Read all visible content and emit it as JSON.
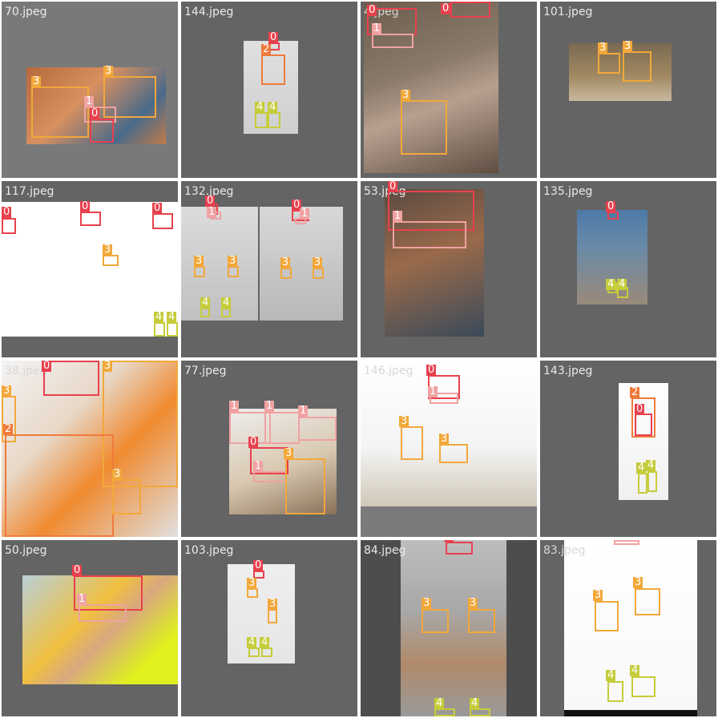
{
  "grid": {
    "tiles": [
      {
        "filename": "70.jpeg",
        "labels": [
          "3",
          "3",
          "1",
          "0"
        ]
      },
      {
        "filename": "144.jpeg",
        "labels": [
          "0",
          "2",
          "4",
          "4"
        ]
      },
      {
        "filename": "4.jpeg",
        "labels": [
          "0",
          "0",
          "1",
          "3"
        ]
      },
      {
        "filename": "101.jpeg",
        "labels": [
          "3",
          "3"
        ]
      },
      {
        "filename": "117.jpeg",
        "labels": [
          "0",
          "0",
          "0",
          "3",
          "4",
          "4"
        ]
      },
      {
        "filename": "132.jpeg",
        "labels": [
          "0",
          "1",
          "3",
          "3",
          "4",
          "4",
          "0",
          "1",
          "3",
          "3"
        ]
      },
      {
        "filename": "53.jpeg",
        "labels": [
          "0",
          "1"
        ]
      },
      {
        "filename": "135.jpeg",
        "labels": [
          "0",
          "4",
          "4"
        ]
      },
      {
        "filename": "38.jpeg",
        "labels": [
          "0",
          "3",
          "3",
          "2",
          "3"
        ]
      },
      {
        "filename": "77.jpeg",
        "labels": [
          "1",
          "1",
          "1",
          "0",
          "1",
          "3"
        ]
      },
      {
        "filename": "146.jpeg",
        "labels": [
          "0",
          "1",
          "3",
          "3"
        ]
      },
      {
        "filename": "143.jpeg",
        "labels": [
          "2",
          "0",
          "4",
          "4"
        ]
      },
      {
        "filename": "50.jpeg",
        "labels": [
          "0",
          "1"
        ]
      },
      {
        "filename": "103.jpeg",
        "labels": [
          "0",
          "3",
          "3",
          "4",
          "4"
        ]
      },
      {
        "filename": "84.jpeg",
        "labels": [
          "0",
          "3",
          "3",
          "4",
          "4"
        ]
      },
      {
        "filename": "83.jpeg",
        "labels": [
          "1",
          "3",
          "3",
          "4",
          "4"
        ]
      }
    ]
  },
  "colors": {
    "class_0": "#e8414e",
    "class_1": "#f0a2a2",
    "class_2": "#f07a3c",
    "class_3": "#f2a83a",
    "class_4": "#c6cc3a",
    "tile_background": "#646464"
  }
}
